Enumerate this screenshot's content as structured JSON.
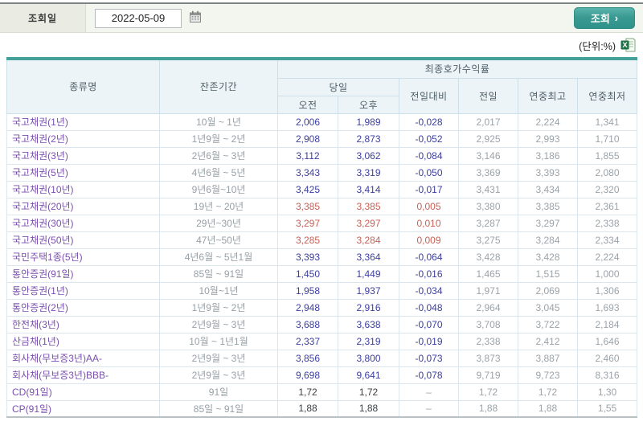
{
  "query_bar": {
    "label": "조회일",
    "date_value": "2022-05-09",
    "search_label": "조회",
    "search_arrow": "›"
  },
  "unit_label": "(단위:%)",
  "table": {
    "header": {
      "type": "종류명",
      "period": "잔존기간",
      "yield_group": "최종호가수익률",
      "today": "당일",
      "am": "오전",
      "pm": "오후",
      "vs_prev": "전일대비",
      "prev": "전일",
      "year_high": "연중최고",
      "year_low": "연중최저"
    },
    "rows": [
      {
        "name": "국고채권(1년)",
        "period": "10월 ~ 1년",
        "am": "2,006",
        "pm": "1,989",
        "chg": "-0,028",
        "prev": "2,017",
        "high": "2,224",
        "low": "1,341",
        "trend": "down"
      },
      {
        "name": "국고채권(2년)",
        "period": "1년9월 ~ 2년",
        "am": "2,908",
        "pm": "2,873",
        "chg": "-0,052",
        "prev": "2,925",
        "high": "2,993",
        "low": "1,710",
        "trend": "down"
      },
      {
        "name": "국고채권(3년)",
        "period": "2년6월 ~ 3년",
        "am": "3,112",
        "pm": "3,062",
        "chg": "-0,084",
        "prev": "3,146",
        "high": "3,186",
        "low": "1,855",
        "trend": "down"
      },
      {
        "name": "국고채권(5년)",
        "period": "4년6월 ~ 5년",
        "am": "3,343",
        "pm": "3,319",
        "chg": "-0,050",
        "prev": "3,369",
        "high": "3,393",
        "low": "2,080",
        "trend": "down"
      },
      {
        "name": "국고채권(10년)",
        "period": "9년6월~10년",
        "am": "3,425",
        "pm": "3,414",
        "chg": "-0,017",
        "prev": "3,431",
        "high": "3,434",
        "low": "2,320",
        "trend": "down"
      },
      {
        "name": "국고채권(20년)",
        "period": "19년 ~ 20년",
        "am": "3,385",
        "pm": "3,385",
        "chg": "0,005",
        "prev": "3,380",
        "high": "3,385",
        "low": "2,361",
        "trend": "up"
      },
      {
        "name": "국고채권(30년)",
        "period": "29년~30년",
        "am": "3,297",
        "pm": "3,297",
        "chg": "0,010",
        "prev": "3,287",
        "high": "3,297",
        "low": "2,338",
        "trend": "up"
      },
      {
        "name": "국고채권(50년)",
        "period": "47년~50년",
        "am": "3,285",
        "pm": "3,284",
        "chg": "0,009",
        "prev": "3,275",
        "high": "3,284",
        "low": "2,334",
        "trend": "up"
      },
      {
        "name": "국민주택1종(5년)",
        "period": "4년6월 ~ 5년1월",
        "am": "3,393",
        "pm": "3,364",
        "chg": "-0,064",
        "prev": "3,428",
        "high": "3,428",
        "low": "2,224",
        "trend": "down"
      },
      {
        "name": "통안증권(91일)",
        "period": "85일 ~ 91일",
        "am": "1,450",
        "pm": "1,449",
        "chg": "-0,016",
        "prev": "1,465",
        "high": "1,515",
        "low": "1,000",
        "trend": "down"
      },
      {
        "name": "통안증권(1년)",
        "period": "10월~1년",
        "am": "1,958",
        "pm": "1,937",
        "chg": "-0,034",
        "prev": "1,971",
        "high": "2,069",
        "low": "1,306",
        "trend": "down"
      },
      {
        "name": "통안증권(2년)",
        "period": "1년9월 ~ 2년",
        "am": "2,948",
        "pm": "2,916",
        "chg": "-0,048",
        "prev": "2,964",
        "high": "3,045",
        "low": "1,693",
        "trend": "down"
      },
      {
        "name": "한전채(3년)",
        "period": "2년9월 ~ 3년",
        "am": "3,688",
        "pm": "3,638",
        "chg": "-0,070",
        "prev": "3,708",
        "high": "3,722",
        "low": "2,184",
        "trend": "down"
      },
      {
        "name": "산금채(1년)",
        "period": "10월 ~ 1년1월",
        "am": "2,337",
        "pm": "2,319",
        "chg": "-0,019",
        "prev": "2,338",
        "high": "2,412",
        "low": "1,646",
        "trend": "down"
      },
      {
        "name": "회사채(무보증3년)AA-",
        "period": "2년9월 ~ 3년",
        "am": "3,856",
        "pm": "3,800",
        "chg": "-0,073",
        "prev": "3,873",
        "high": "3,887",
        "low": "2,460",
        "trend": "down"
      },
      {
        "name": "회사채(무보증3년)BBB-",
        "period": "2년9월 ~ 3년",
        "am": "9,698",
        "pm": "9,641",
        "chg": "-0,078",
        "prev": "9,719",
        "high": "9,723",
        "low": "8,316",
        "trend": "down"
      },
      {
        "name": "CD(91일)",
        "period": "91일",
        "am": "1,72",
        "pm": "1,72",
        "chg": "–",
        "prev": "1,72",
        "high": "1,72",
        "low": "1,30",
        "trend": "flat"
      },
      {
        "name": "CP(91일)",
        "period": "85일 ~ 91일",
        "am": "1,88",
        "pm": "1,88",
        "chg": "–",
        "prev": "1,88",
        "high": "1,88",
        "low": "1,55",
        "trend": "flat"
      }
    ]
  },
  "colors": {
    "accent_teal": "#44a19a",
    "negative_navy": "#3b3ea0",
    "positive_red": "#c75f54",
    "muted_gray": "#9ba3a9",
    "name_purple": "#7a4fae"
  }
}
